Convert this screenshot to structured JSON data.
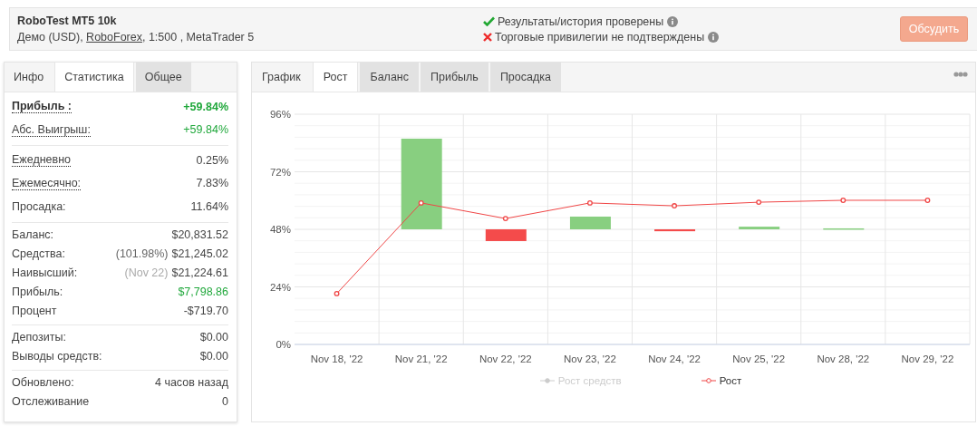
{
  "header": {
    "title": "RoboTest MT5 10k",
    "subtitle_start": "Демо (USD), ",
    "broker_link": "RoboForex",
    "subtitle_end": ", 1:500 , MetaTrader 5",
    "checks": [
      {
        "text": "Результаты/история проверены",
        "passed": true
      },
      {
        "text": "Торговые привилегии не подтверждены",
        "passed": false
      }
    ],
    "button": "Обсудить"
  },
  "stats": {
    "tabs": [
      {
        "label": "Инфо",
        "selected": false,
        "kind": "plain"
      },
      {
        "label": "Статистика",
        "selected": true,
        "kind": "plain"
      },
      {
        "label": "Общее",
        "selected": false,
        "kind": "boxed"
      }
    ],
    "groups": [
      {
        "rows": [
          {
            "label": "Прибыль :",
            "value": "+59.84%",
            "underlined": true,
            "bold": true,
            "positive": true
          },
          {
            "label": "Абс. Выигрыш:",
            "value": "+59.84%",
            "underlined": true,
            "bold": false,
            "positive": true
          }
        ]
      },
      {
        "rows": [
          {
            "label": "Ежедневно",
            "value": "0.25%",
            "underlined": true,
            "bold": false,
            "positive": false
          },
          {
            "label": "Ежемесячно:",
            "value": "7.83%",
            "underlined": true,
            "bold": false,
            "positive": false
          },
          {
            "label": "Просадка:",
            "value": "11.64%",
            "underlined": false,
            "bold": false,
            "positive": false
          }
        ]
      },
      {
        "rows": [
          {
            "label": "Баланс:",
            "value": "$20,831.52",
            "underlined": false,
            "bold": false,
            "positive": false
          },
          {
            "label": "Средства:",
            "note": "(101.98%)",
            "value": "$21,245.02",
            "underlined": false,
            "bold": false,
            "positive": false
          },
          {
            "label": "Наивысший:",
            "note": "(Nov 22)",
            "value": "$21,224.61",
            "underlined": false,
            "bold": false,
            "positive": false
          },
          {
            "label": "Прибыль:",
            "value": "$7,798.86",
            "underlined": false,
            "bold": false,
            "positive": true
          },
          {
            "label": "Процент",
            "value": "-$719.70",
            "underlined": false,
            "bold": false,
            "positive": false
          }
        ]
      },
      {
        "rows": [
          {
            "label": "Депозиты:",
            "value": "$0.00",
            "underlined": false,
            "bold": false,
            "positive": false
          },
          {
            "label": "Выводы средств:",
            "value": "$0.00",
            "underlined": false,
            "bold": false,
            "positive": false
          }
        ]
      },
      {
        "rows": [
          {
            "label": "Обновлено:",
            "value": "4 часов назад",
            "underlined": false,
            "bold": false,
            "positive": false
          },
          {
            "label": "Отслеживание",
            "value": "0",
            "underlined": false,
            "bold": false,
            "positive": false
          }
        ]
      }
    ]
  },
  "chart": {
    "tabs": [
      {
        "label": "График",
        "selected": false,
        "kind": "plain"
      },
      {
        "label": "Рост",
        "selected": true,
        "kind": "plain"
      },
      {
        "label": "Баланс",
        "selected": false,
        "kind": "boxed"
      },
      {
        "label": "Прибыль",
        "selected": false,
        "kind": "boxed"
      },
      {
        "label": "Просадка",
        "selected": false,
        "kind": "boxed"
      }
    ],
    "chart_data": {
      "type": "line",
      "categories": [
        "Nov 18, '22",
        "Nov 21, '22",
        "Nov 22, '22",
        "Nov 23, '22",
        "Nov 24, '22",
        "Nov 25, '22",
        "Nov 28, '22",
        "Nov 29, '22"
      ],
      "ylim": [
        0,
        96
      ],
      "yticks": [
        {
          "value": 0,
          "label": "0%"
        },
        {
          "value": 24,
          "label": "24%"
        },
        {
          "value": 48,
          "label": "48%"
        },
        {
          "value": 72,
          "label": "72%"
        },
        {
          "value": 96,
          "label": "96%"
        }
      ],
      "grid": true,
      "series": [
        {
          "name": "Рост",
          "color": "#f04646",
          "marker": "circle",
          "values": [
            21.2,
            59,
            52.5,
            59,
            57.8,
            59.3,
            60.1,
            60.1
          ]
        },
        {
          "type": "bar",
          "colors": [
            null,
            "#88cf80",
            "#f44b4b",
            "#88cf80",
            "#f44b4b",
            "#88cf80",
            "#88cf80",
            null
          ],
          "base": [
            null,
            48,
            48,
            48,
            48,
            48,
            48,
            null
          ],
          "values": [
            null,
            37.8,
            -4.9,
            5.3,
            -0.8,
            1.1,
            0.4,
            null
          ]
        }
      ]
    },
    "legend": [
      {
        "label": "Рост средств",
        "enabled": false
      }
    ]
  }
}
